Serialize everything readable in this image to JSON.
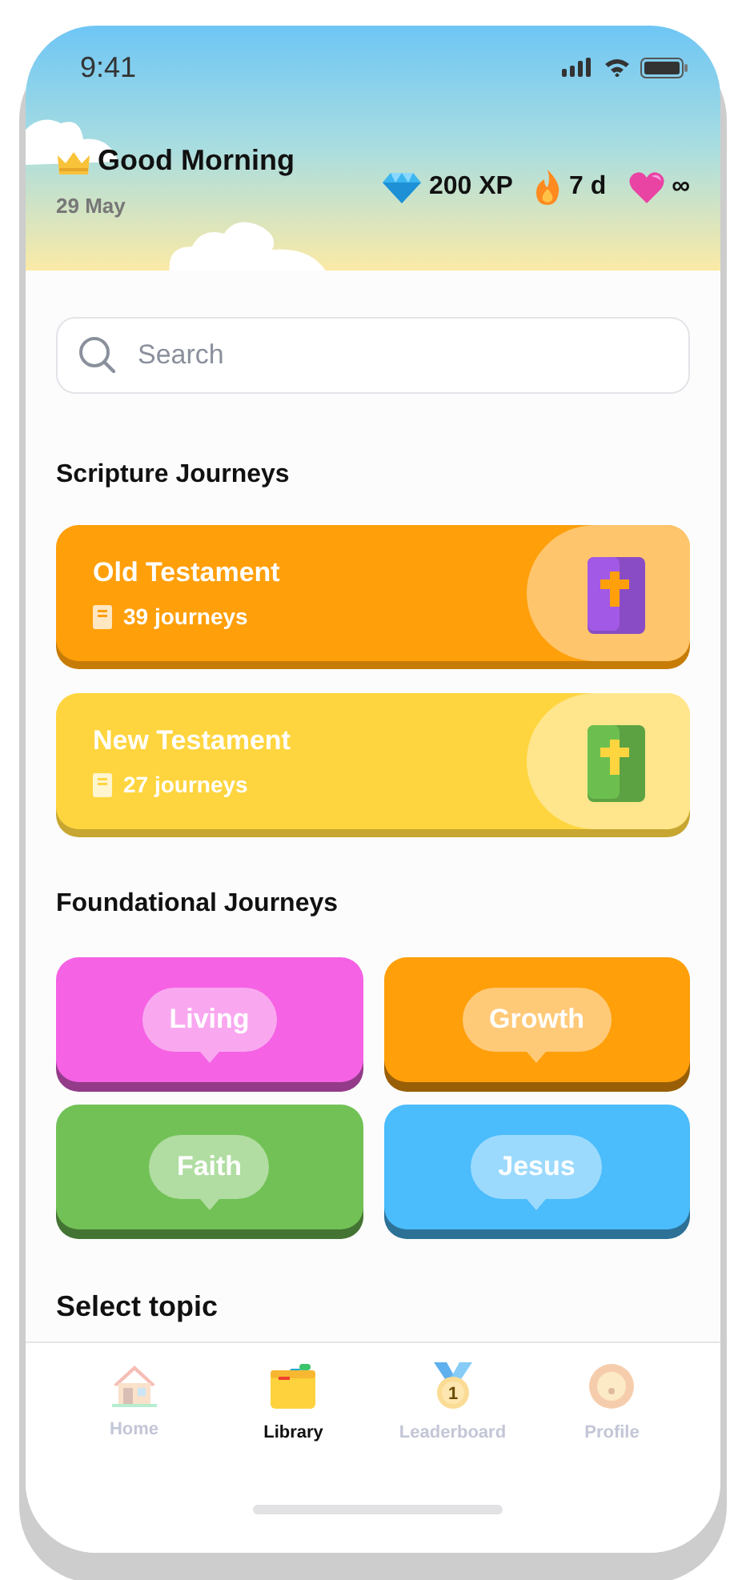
{
  "status_bar": {
    "time": "9:41"
  },
  "greeting": {
    "title": "Good Morning",
    "date": "29 May"
  },
  "stats": [
    {
      "kind": "xp",
      "value": "200 XP"
    },
    {
      "kind": "streak",
      "value": "7 d"
    },
    {
      "kind": "lives",
      "value": "∞"
    }
  ],
  "search": {
    "placeholder": "Search"
  },
  "scripture": {
    "title": "Scripture Journeys",
    "cards": [
      {
        "kind": "old",
        "title": "Old Testament",
        "count": "39 journeys",
        "color": "#ff9f0a"
      },
      {
        "kind": "new",
        "title": "New Testament",
        "count": "27 journeys",
        "color": "#ffd53f"
      }
    ]
  },
  "foundational": {
    "title": "Foundational Journeys",
    "tiles": [
      {
        "label": "Living",
        "color": "#f562e4"
      },
      {
        "label": "Growth",
        "color": "#ff9f0a"
      },
      {
        "label": "Faith",
        "color": "#72c156"
      },
      {
        "label": "Jesus",
        "color": "#4bbcfc"
      }
    ]
  },
  "topics": {
    "title": "Select topic"
  },
  "tabs": [
    {
      "kind": "home",
      "label": "Home",
      "selected": false
    },
    {
      "kind": "library",
      "label": "Library",
      "selected": true
    },
    {
      "kind": "leaderboard",
      "label": "Leaderboard",
      "selected": false,
      "badge": "1"
    },
    {
      "kind": "profile",
      "label": "Profile",
      "selected": false
    }
  ]
}
